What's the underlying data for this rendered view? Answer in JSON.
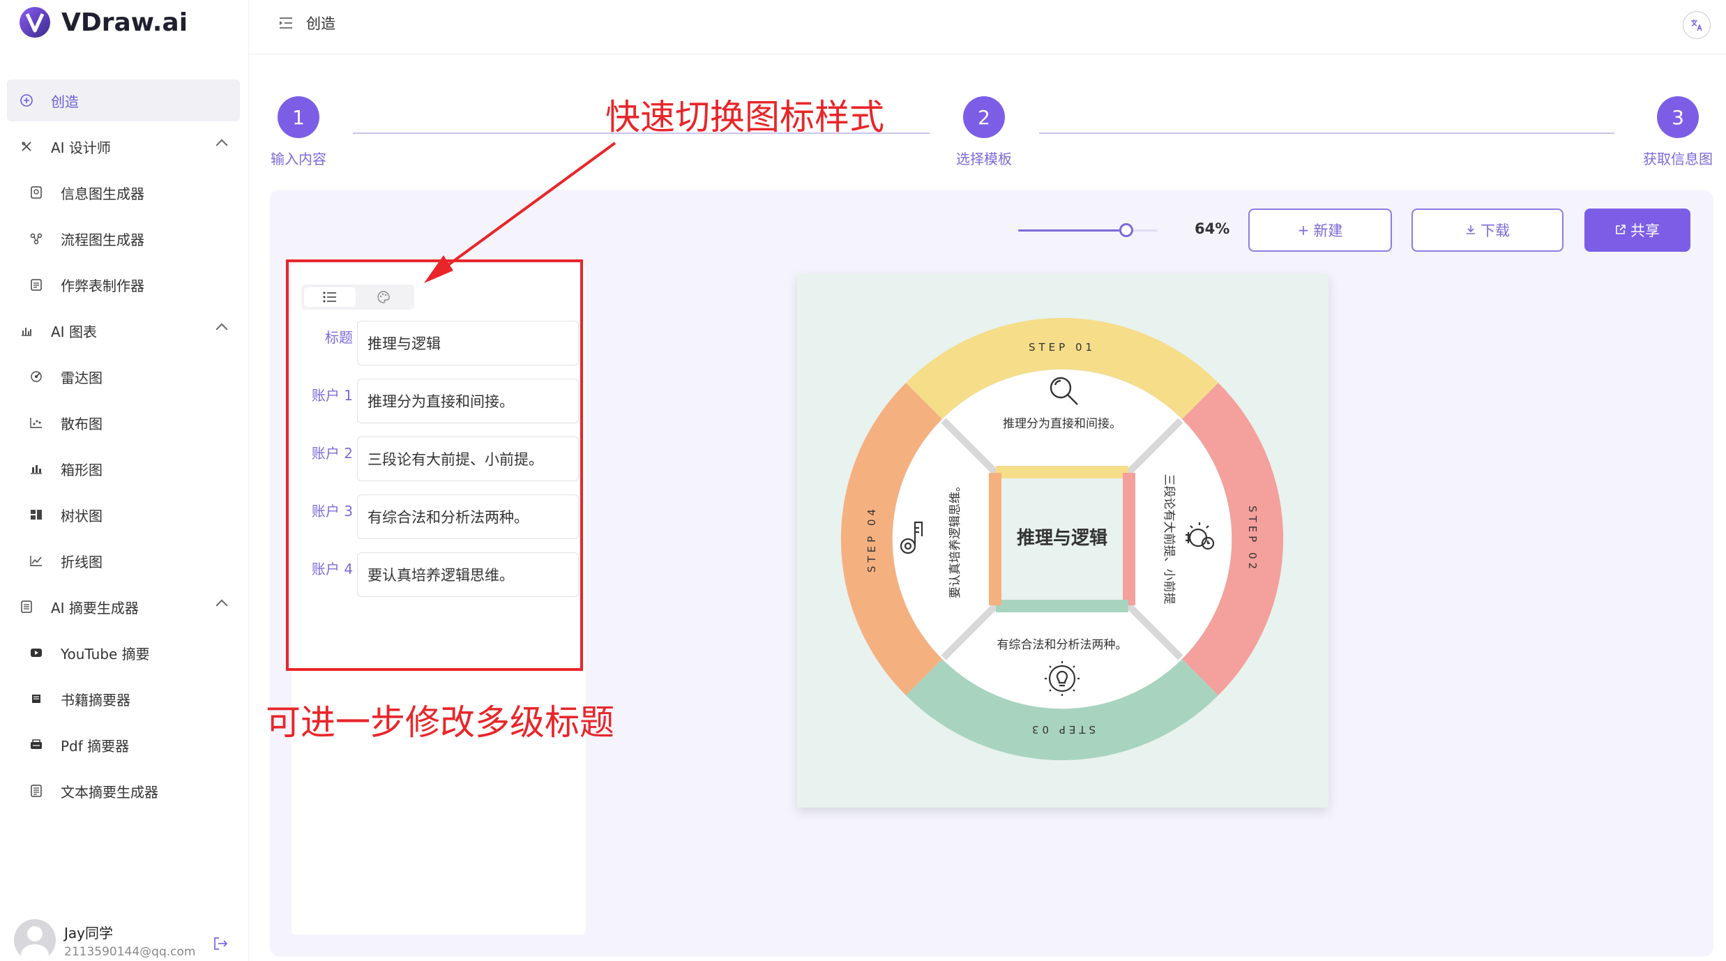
{
  "app": {
    "name": "VDraw.ai"
  },
  "sidebar": {
    "items": [
      {
        "label": "创造",
        "icon": "plus-circle-icon",
        "active": true
      },
      {
        "label": "AI 设计师",
        "icon": "design-icon",
        "group": true
      },
      {
        "label": "信息图生成器",
        "icon": "infographic-icon"
      },
      {
        "label": "流程图生成器",
        "icon": "flowchart-icon"
      },
      {
        "label": "作弊表制作器",
        "icon": "cheatsheet-icon"
      },
      {
        "label": "AI 图表",
        "icon": "chart-icon",
        "group": true
      },
      {
        "label": "雷达图",
        "icon": "radar-icon"
      },
      {
        "label": "散布图",
        "icon": "scatter-icon"
      },
      {
        "label": "箱形图",
        "icon": "boxplot-icon"
      },
      {
        "label": "树状图",
        "icon": "treemap-icon"
      },
      {
        "label": "折线图",
        "icon": "linechart-icon"
      },
      {
        "label": "AI 摘要生成器",
        "icon": "summary-icon",
        "group": true
      },
      {
        "label": "YouTube 摘要",
        "icon": "youtube-icon"
      },
      {
        "label": "书籍摘要器",
        "icon": "book-icon"
      },
      {
        "label": "Pdf 摘要器",
        "icon": "pdf-icon"
      },
      {
        "label": "文本摘要生成器",
        "icon": "text-doc-icon"
      }
    ]
  },
  "user": {
    "name": "Jay同学",
    "email": "2113590144@qq.com"
  },
  "header": {
    "breadcrumb": "创造",
    "lang_icon": "translate-icon"
  },
  "steps": [
    {
      "number": "1",
      "label": "输入内容"
    },
    {
      "number": "2",
      "label": "选择模板"
    },
    {
      "number": "3",
      "label": "获取信息图"
    }
  ],
  "toolbar": {
    "zoom": "64%",
    "zoom_level": 0.64,
    "new_label": "新建",
    "download_label": "下载",
    "share_label": "共享"
  },
  "editor": {
    "fields": [
      {
        "label": "标题",
        "value": "推理与逻辑"
      },
      {
        "label": "账户 1",
        "value": "推理分为直接和间接。"
      },
      {
        "label": "账户 2",
        "value": "三段论有大前提、小前提。"
      },
      {
        "label": "账户 3",
        "value": "有综合法和分析法两种。"
      },
      {
        "label": "账户 4",
        "value": "要认真培养逻辑思维。"
      }
    ]
  },
  "infographic": {
    "title": "推理与逻辑",
    "steps": [
      {
        "label": "STEP 01",
        "text": "推理分为直接和间接。",
        "color": "#f5dd8a"
      },
      {
        "label": "STEP 02",
        "text": "三段论有大前提、小前提",
        "color": "#f4a09c"
      },
      {
        "label": "STEP 03",
        "text": "有综合法和分析法两种。",
        "color": "#a8d4bf"
      },
      {
        "label": "STEP 04",
        "text": "要认真培养逻辑思维。",
        "color": "#f5b080"
      }
    ]
  },
  "annotations": {
    "top": "快速切换图标样式",
    "bottom": "可进一步修改多级标题"
  },
  "colors": {
    "accent": "#7c5ee6",
    "annotation": "#e8262a"
  }
}
